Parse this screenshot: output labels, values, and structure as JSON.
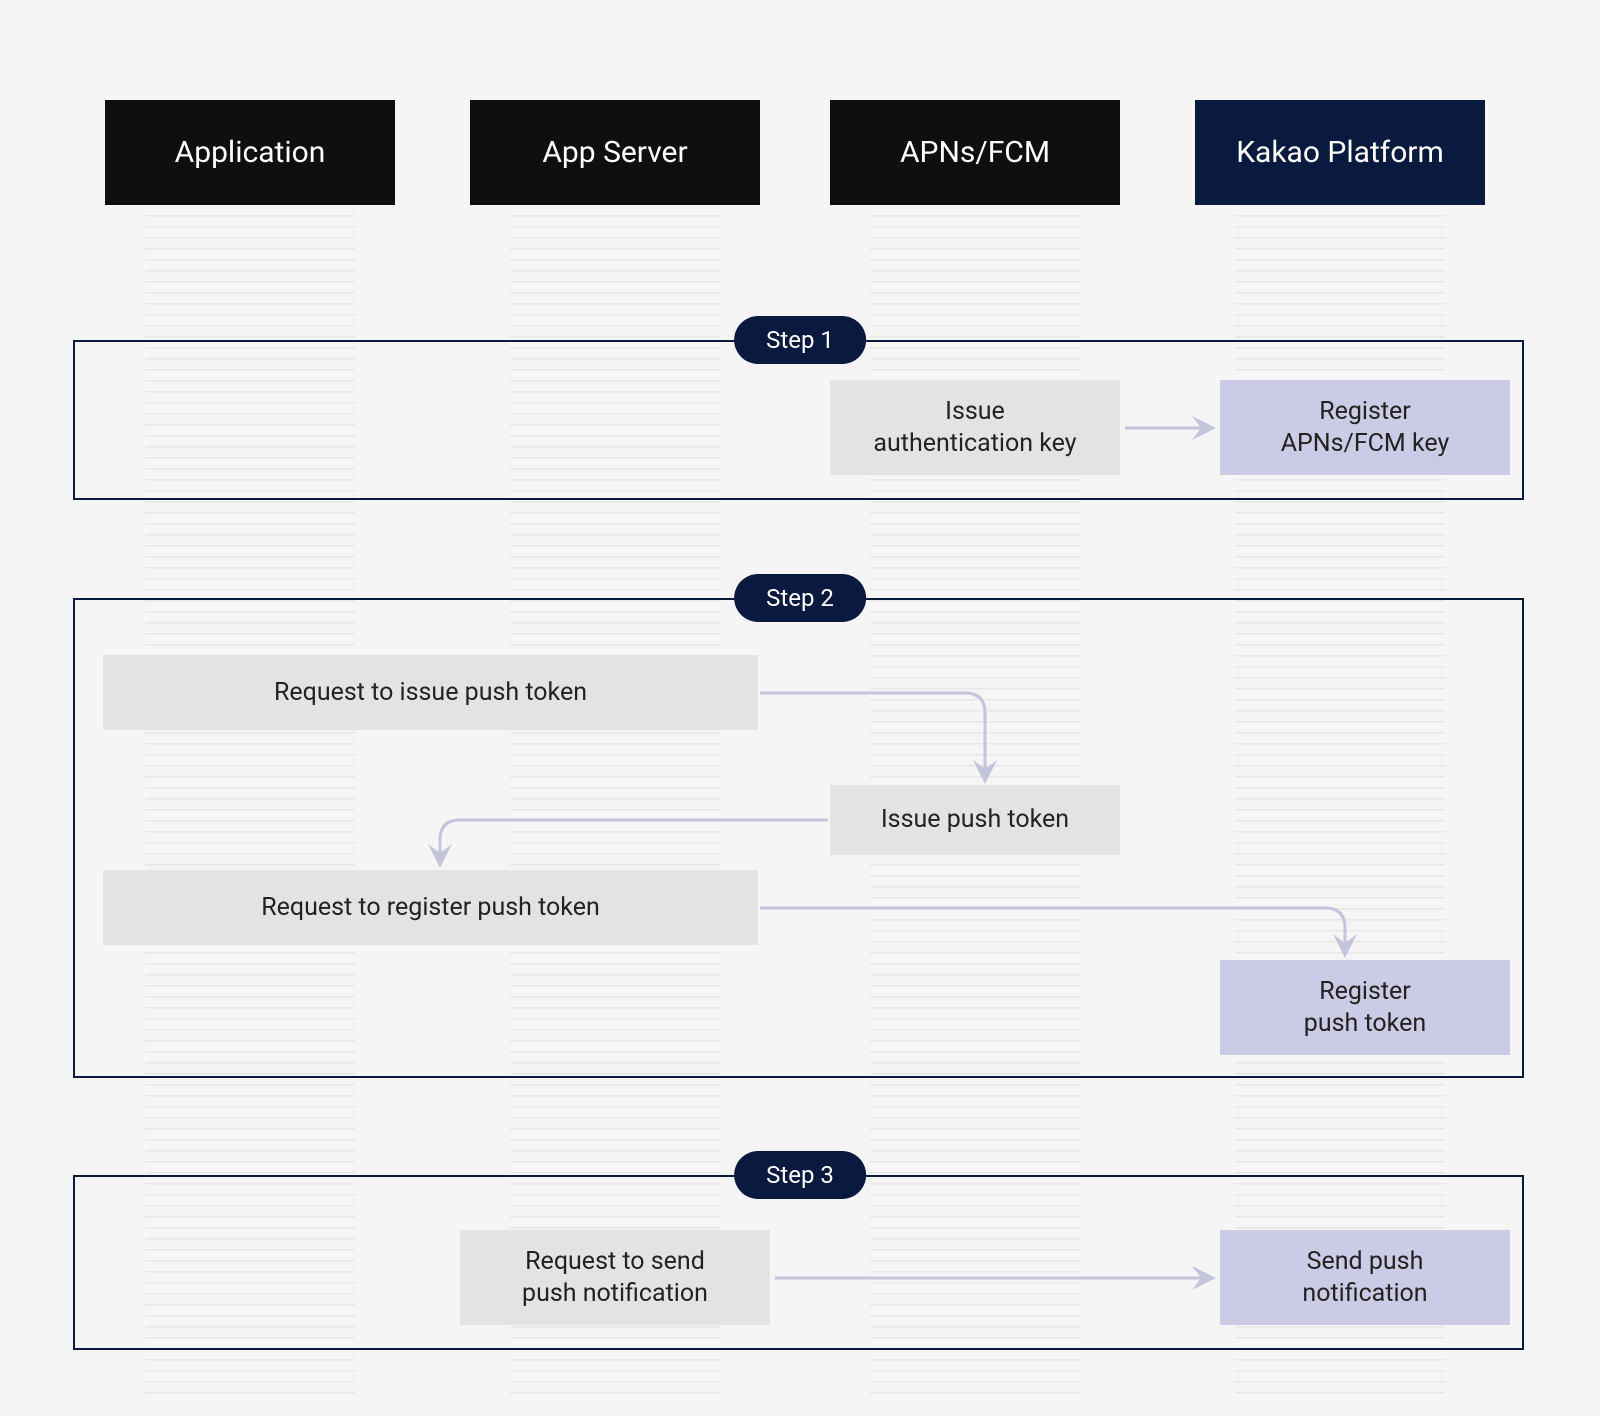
{
  "columns": {
    "application": "Application",
    "app_server": "App Server",
    "apns_fcm": "APNs/FCM",
    "kakao": "Kakao Platform"
  },
  "steps": {
    "s1": {
      "label": "Step 1"
    },
    "s2": {
      "label": "Step 2"
    },
    "s3": {
      "label": "Step 3"
    }
  },
  "nodes": {
    "issue_auth_key": "Issue\nauthentication key",
    "register_key": "Register\nAPNs/FCM key",
    "req_issue_token": "Request to issue push token",
    "issue_token": "Issue push token",
    "req_register_token": "Request to register push token",
    "register_token": "Register\npush token",
    "req_send_push": "Request to send\npush notification",
    "send_push": "Send push\nnotification"
  }
}
